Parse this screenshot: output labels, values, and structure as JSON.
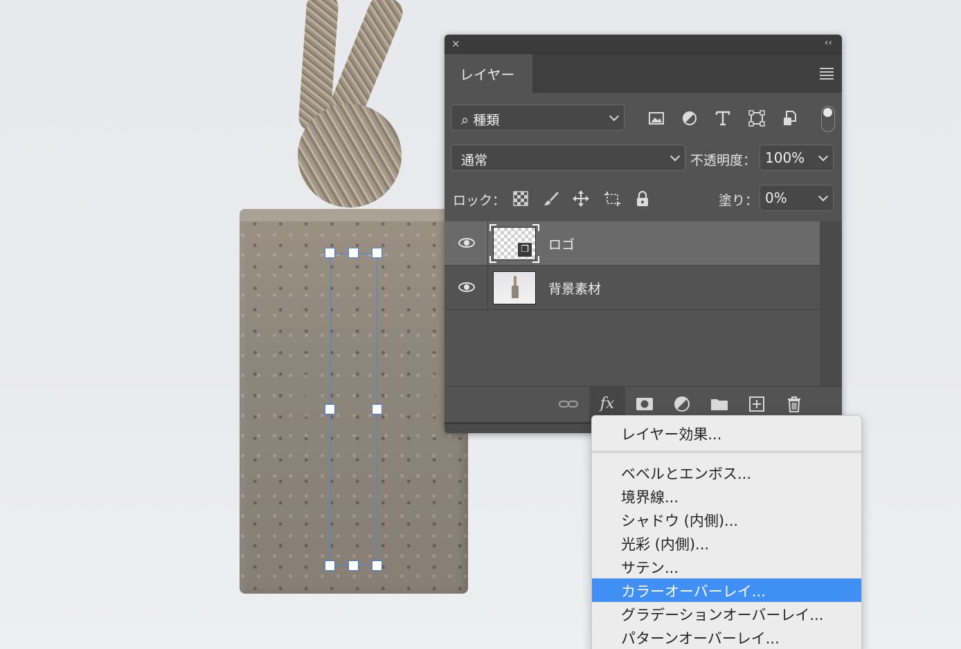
{
  "panel": {
    "close_glyph": "×",
    "collapse_glyph": "‹‹",
    "tab_label": "レイヤー",
    "filter": {
      "search_glyph": "⌕",
      "label": "種類"
    },
    "blend_mode": "通常",
    "opacity": {
      "label": "不透明度：",
      "value": "100%"
    },
    "lock": {
      "label": "ロック："
    },
    "fill": {
      "label": "塗り：",
      "value": "0%"
    },
    "layers": [
      {
        "name": "ロゴ",
        "visible": true,
        "selected": true,
        "thumbnail": "transparent-checker"
      },
      {
        "name": "背景素材",
        "visible": true,
        "selected": false,
        "thumbnail": "photo"
      }
    ],
    "bottom_fx_label": "fx"
  },
  "context_menu": {
    "items": [
      {
        "label": "レイヤー効果...",
        "highlighted": false
      },
      {
        "label": "ベベルとエンボス...",
        "highlighted": false
      },
      {
        "label": "境界線...",
        "highlighted": false
      },
      {
        "label": "シャドウ (内側)...",
        "highlighted": false
      },
      {
        "label": "光彩 (内側)...",
        "highlighted": false
      },
      {
        "label": "サテン...",
        "highlighted": false
      },
      {
        "label": "カラーオーバーレイ...",
        "highlighted": true
      },
      {
        "label": "グラデーションオーバーレイ...",
        "highlighted": false
      },
      {
        "label": "パターンオーバーレイ...",
        "highlighted": false
      }
    ]
  },
  "colors": {
    "panel_bg": "#535353",
    "menu_highlight": "#3f8ff4",
    "selection_blue": "#4a86e0"
  }
}
